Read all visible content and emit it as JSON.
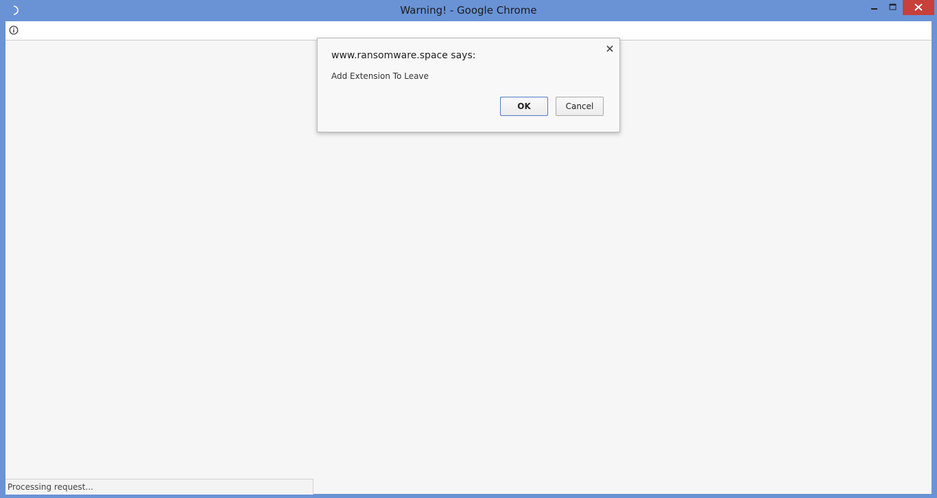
{
  "window": {
    "title": "Warning! - Google Chrome",
    "controls": {
      "minimize_icon": "minimize-icon",
      "maximize_icon": "maximize-icon",
      "close_icon": "close-icon"
    }
  },
  "addressbar": {
    "icon": "info-icon",
    "url": ""
  },
  "dialog": {
    "title": "www.ransomware.space says:",
    "message": "Add Extension To Leave",
    "ok_label": "OK",
    "cancel_label": "Cancel"
  },
  "statusbar": {
    "text": "Processing request..."
  },
  "colors": {
    "frame": "#6a93d6",
    "close_button": "#c7403a",
    "content_bg": "#f6f6f6",
    "ok_border": "#4d7cc4"
  }
}
